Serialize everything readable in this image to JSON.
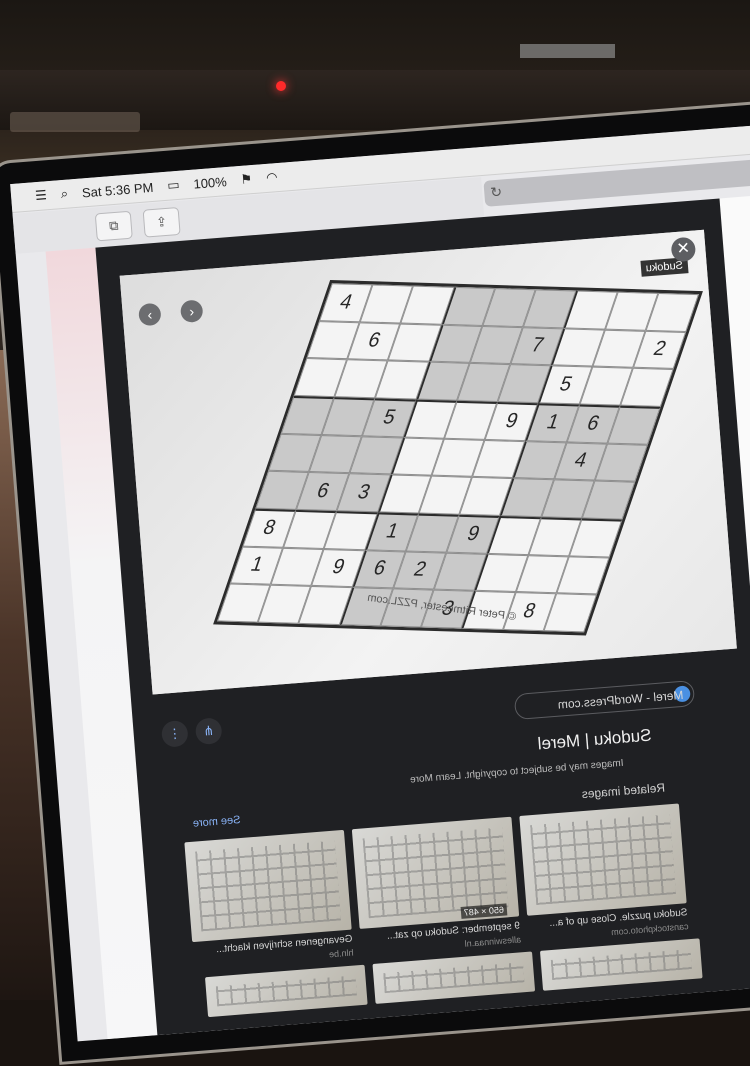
{
  "menubar": {
    "time": "Sat 5:36 PM",
    "battery": "100%"
  },
  "viewer": {
    "source": "Merel - WordPress.com",
    "title": "Sudoku | Merel",
    "copyright": "Images may be subject to copyright. Learn More",
    "related_label": "Related images",
    "see_more": "See more",
    "photo_tag": "Sudoku",
    "photo_credit": "© Peter Ritmeester, PZZL.com"
  },
  "sudoku": {
    "cells": [
      [
        "4",
        "",
        "",
        "",
        "",
        "",
        "",
        "",
        ""
      ],
      [
        "",
        "6",
        "",
        "",
        "",
        "7",
        "",
        "",
        "2"
      ],
      [
        "",
        "",
        "",
        "",
        "",
        "",
        "5",
        "",
        ""
      ],
      [
        "",
        "",
        "5",
        "",
        "",
        "9",
        "1",
        "6",
        ""
      ],
      [
        "",
        "",
        "",
        "",
        "",
        "",
        "",
        "4",
        ""
      ],
      [
        "",
        "6",
        "3",
        "",
        "",
        "",
        "",
        "",
        ""
      ],
      [
        "8",
        "",
        "",
        "1",
        "",
        "9",
        "",
        "",
        ""
      ],
      [
        "1",
        "",
        "9",
        "6",
        "2",
        "",
        "",
        "",
        ""
      ],
      [
        "",
        "",
        "",
        "",
        "",
        "3",
        "",
        "8",
        ""
      ]
    ]
  },
  "related": [
    {
      "caption": "Sudoku puzzle. Close up of a...",
      "source": "canstockphoto.com"
    },
    {
      "caption": "9 september: Sudoku op zat...",
      "source": "alleswinnaa.nl",
      "dims": "650 × 487"
    },
    {
      "caption": "Gevangenen schrijven klacht...",
      "source": "hln.be"
    }
  ]
}
